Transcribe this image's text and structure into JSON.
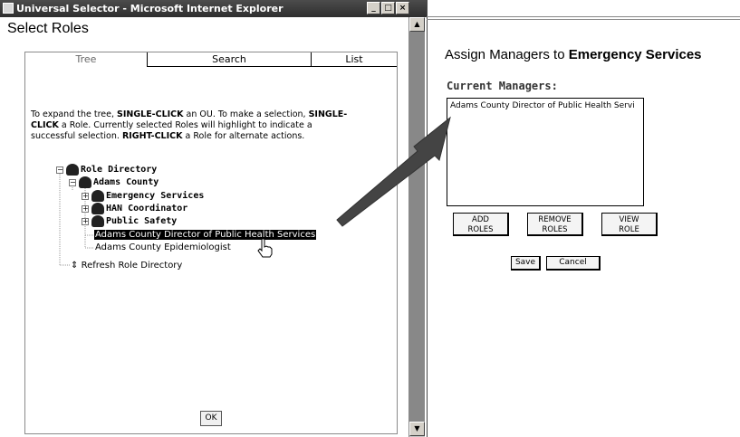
{
  "window": {
    "title": "Universal Selector - Microsoft Internet Explorer",
    "controls": [
      "_",
      "□",
      "×"
    ]
  },
  "dialog": {
    "title": "Select Roles",
    "tabs": [
      {
        "label": "Tree"
      },
      {
        "label": "Search"
      },
      {
        "label": "List"
      }
    ],
    "instructions": [
      {
        "t": "To expand the tree, ",
        "b": false
      },
      {
        "t": "SINGLE-CLICK",
        "b": true
      },
      {
        "t": " an OU. To make a selection, ",
        "b": false
      },
      {
        "t": "SINGLE-CLICK",
        "b": true
      },
      {
        "t": " a Role. Currently selected Roles will highlight to indicate a successful selection. ",
        "b": false
      },
      {
        "t": "RIGHT-CLICK",
        "b": true
      },
      {
        "t": " a Role for alternate actions.",
        "b": false
      }
    ],
    "tree": {
      "root": "Role Directory",
      "county": "Adams County",
      "children": [
        "Emergency Services",
        "HAN Coordinator",
        "Public Safety"
      ],
      "leaves": [
        "Adams County Director of Public Health Services",
        "Adams County Epidemiologist"
      ],
      "refresh": "Refresh Role Directory"
    },
    "ok_label": "OK"
  },
  "assign": {
    "title_prefix": "Assign Managers to ",
    "title_target": "Emergency Services",
    "current_label": "Current Managers:",
    "managers": [
      "Adams County Director of Public Health Servi"
    ],
    "buttons": {
      "add": "ADD\nROLES",
      "remove": "REMOVE\nROLES",
      "view": "VIEW\nROLE"
    },
    "save": "Save",
    "cancel": "Cancel"
  }
}
